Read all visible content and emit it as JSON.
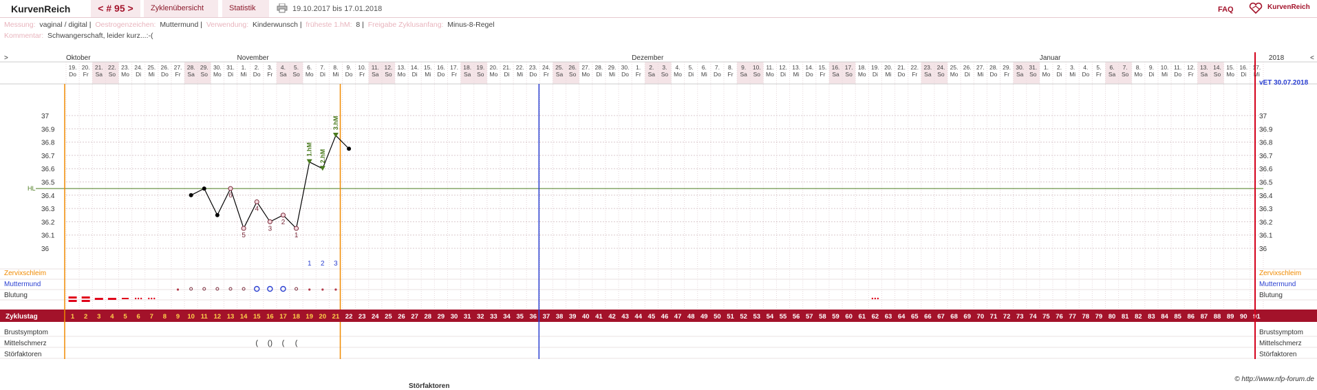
{
  "header": {
    "brand": "KurvenReich",
    "cycle_label": "< # 95 >",
    "tab_overview": "Zyklenübersicht",
    "tab_stats": "Statistik",
    "date_range": "19.10.2017 bis 17.01.2018",
    "faq": "FAQ",
    "logo_text": "KurvenReich"
  },
  "meta": {
    "messung_label": "Messung:",
    "messung_value": "vaginal / digital",
    "oestrogen_label": "Oestrogenzeichen:",
    "oestrogen_value": "Muttermund",
    "verwendung_label": "Verwendung:",
    "verwendung_value": "Kinderwunsch",
    "fruehest_label": "früheste 1.hM:",
    "fruehest_value": "8",
    "freigabe_label": "Freigabe Zyklusanfang:",
    "freigabe_value": "Minus-8-Regel",
    "kommentar_label": "Kommentar:",
    "kommentar_value": "Schwangerschaft, leider kurz...:-("
  },
  "chart_data": {
    "type": "line",
    "series_name": "Temperatur",
    "days": 91,
    "dates": [
      "19.",
      "20.",
      "21.",
      "22.",
      "23.",
      "24.",
      "25.",
      "26.",
      "27.",
      "28.",
      "29.",
      "30.",
      "31.",
      "1.",
      "2.",
      "3.",
      "4.",
      "5.",
      "6.",
      "7.",
      "8.",
      "9.",
      "10.",
      "11.",
      "12.",
      "13.",
      "14.",
      "15.",
      "16.",
      "17.",
      "18.",
      "19.",
      "20.",
      "21.",
      "22.",
      "23.",
      "24.",
      "25.",
      "26.",
      "27.",
      "28.",
      "29.",
      "30.",
      "1.",
      "2.",
      "3.",
      "4.",
      "5.",
      "6.",
      "7.",
      "8.",
      "9.",
      "10.",
      "11.",
      "12.",
      "13.",
      "14.",
      "15.",
      "16.",
      "17.",
      "18.",
      "19.",
      "20.",
      "21.",
      "22.",
      "23.",
      "24.",
      "25.",
      "26.",
      "27.",
      "28.",
      "29.",
      "30.",
      "31.",
      "1.",
      "2.",
      "3.",
      "4.",
      "5.",
      "6.",
      "7.",
      "8.",
      "9.",
      "10.",
      "11.",
      "12.",
      "13.",
      "14.",
      "15.",
      "16.",
      "17."
    ],
    "weekdays": [
      "Do",
      "Fr",
      "Sa",
      "So",
      "Mo",
      "Di",
      "Mi",
      "Do",
      "Fr",
      "Sa",
      "So",
      "Mo",
      "Di",
      "Mi",
      "Do",
      "Fr",
      "Sa",
      "So",
      "Mo",
      "Di",
      "Mi",
      "Do",
      "Fr",
      "Sa",
      "So",
      "Mo",
      "Di",
      "Mi",
      "Do",
      "Fr",
      "Sa",
      "So",
      "Mo",
      "Di",
      "Mi",
      "Do",
      "Fr",
      "Sa",
      "So",
      "Mo",
      "Di",
      "Mi",
      "Do",
      "Fr",
      "Sa",
      "So",
      "Mo",
      "Di",
      "Mi",
      "Do",
      "Fr",
      "Sa",
      "So",
      "Mo",
      "Di",
      "Mi",
      "Do",
      "Fr",
      "Sa",
      "So",
      "Mo",
      "Di",
      "Mi",
      "Do",
      "Fr",
      "Sa",
      "So",
      "Mo",
      "Di",
      "Mi",
      "Do",
      "Fr",
      "Sa",
      "So",
      "Mo",
      "Di",
      "Mi",
      "Do",
      "Fr",
      "Sa",
      "So",
      "Mo",
      "Di",
      "Mi",
      "Do",
      "Fr",
      "Sa",
      "So",
      "Mo",
      "Di",
      "Mi"
    ],
    "months": [
      {
        "name": "Oktober",
        "start_day": 1
      },
      {
        "name": "November",
        "start_day": 14
      },
      {
        "name": "Dezember",
        "start_day": 44
      },
      {
        "name": "Januar",
        "start_day": 75
      },
      {
        "name": "2018",
        "start_day": 92
      }
    ],
    "temps": [
      {
        "day": 10,
        "t": 36.4
      },
      {
        "day": 11,
        "t": 36.45
      },
      {
        "day": 12,
        "t": 36.25
      },
      {
        "day": 13,
        "t": 36.45,
        "label": "6"
      },
      {
        "day": 14,
        "t": 36.15,
        "label": "5"
      },
      {
        "day": 15,
        "t": 36.35,
        "label": "4"
      },
      {
        "day": 16,
        "t": 36.2,
        "label": "3"
      },
      {
        "day": 17,
        "t": 36.25,
        "label": "2"
      },
      {
        "day": 18,
        "t": 36.15,
        "label": "1"
      },
      {
        "day": 19,
        "t": 36.65,
        "hm": "1.hM"
      },
      {
        "day": 20,
        "t": 36.6,
        "hm": "2.hM"
      },
      {
        "day": 21,
        "t": 36.85,
        "hm": "3.hM"
      },
      {
        "day": 22,
        "t": 36.75
      }
    ],
    "y_ticks": [
      "37",
      "36.9",
      "36.8",
      "36.7",
      "36.6",
      "36.5",
      "36.4",
      "36.3",
      "36.2",
      "36.1",
      "36"
    ],
    "ylim": [
      36.0,
      37.0
    ],
    "hl_label": "HL",
    "hl_value": 36.45,
    "count_labels": [
      {
        "day": 19,
        "n": "1"
      },
      {
        "day": 20,
        "n": "2"
      },
      {
        "day": 21,
        "n": "3"
      }
    ],
    "vet": "vET 30.07.2018",
    "today_day": 37,
    "cycle_end_day": 21,
    "row_labels": {
      "zervix": "Zervixschleim",
      "mumu": "Muttermund",
      "blutung": "Blutung",
      "zyklustag": "Zyklustag",
      "brust": "Brustsymptom",
      "mittel": "Mittelschmerz",
      "stoer": "Störfaktoren"
    },
    "bleeding": [
      {
        "day": 1,
        "level": 3
      },
      {
        "day": 2,
        "level": 3
      },
      {
        "day": 3,
        "level": 2
      },
      {
        "day": 4,
        "level": 2
      },
      {
        "day": 5,
        "level": 1
      },
      {
        "day": 6,
        "level": 0
      },
      {
        "day": 7,
        "level": 0
      },
      {
        "day": 62,
        "level": 0
      }
    ],
    "muttermund": [
      {
        "day": 9,
        "k": "dot"
      },
      {
        "day": 10,
        "k": "small"
      },
      {
        "day": 11,
        "k": "small"
      },
      {
        "day": 12,
        "k": "small"
      },
      {
        "day": 13,
        "k": "small"
      },
      {
        "day": 14,
        "k": "small"
      },
      {
        "day": 15,
        "k": "big"
      },
      {
        "day": 16,
        "k": "big"
      },
      {
        "day": 17,
        "k": "big"
      },
      {
        "day": 18,
        "k": "small"
      },
      {
        "day": 19,
        "k": "dot"
      },
      {
        "day": 20,
        "k": "dot"
      },
      {
        "day": 21,
        "k": "dot"
      }
    ],
    "mittelschmerz": [
      {
        "day": 15,
        "s": "("
      },
      {
        "day": 16,
        "s": "()"
      },
      {
        "day": 17,
        "s": "("
      },
      {
        "day": 18,
        "s": "("
      }
    ],
    "nav_left": ">",
    "nav_right": "<"
  },
  "footer": {
    "copyright": "© http://www.nfp-forum.de",
    "cutoff": "Störfaktoren"
  },
  "colors": {
    "accent": "#a3122a",
    "weekend": "#f4e4e7",
    "orange": "#f08a00",
    "blue": "#2a3fd1",
    "green": "#4a7a1e"
  }
}
